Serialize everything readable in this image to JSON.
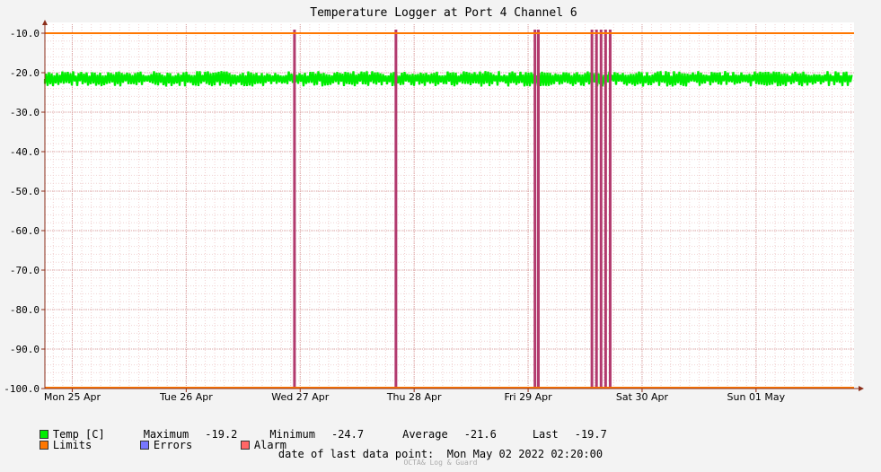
{
  "chart_data": {
    "type": "line",
    "title": "Temperature Logger at Port 4 Channel 6",
    "ylim": [
      -100,
      -10
    ],
    "yticks": [
      -10,
      -20,
      -30,
      -40,
      -50,
      -60,
      -70,
      -80,
      -90,
      -100
    ],
    "ytick_labels": [
      "-10.0",
      "-20.0",
      "-30.0",
      "-40.0",
      "-50.0",
      "-60.0",
      "-70.0",
      "-80.0",
      "-90.0",
      "-100.0"
    ],
    "x_range_days": [
      -0.24,
      6.86
    ],
    "x_ticks": [
      {
        "day": 0,
        "label": "Mon 25 Apr"
      },
      {
        "day": 1,
        "label": "Tue 26 Apr"
      },
      {
        "day": 2,
        "label": "Wed 27 Apr"
      },
      {
        "day": 3,
        "label": "Thu 28 Apr"
      },
      {
        "day": 4,
        "label": "Fri 29 Apr"
      },
      {
        "day": 5,
        "label": "Sat 30 Apr"
      },
      {
        "day": 6,
        "label": "Sun 01 May"
      }
    ],
    "grid": true,
    "series": [
      {
        "name": "Temp [C]",
        "color": "#00ee00",
        "band": [
          -24.7,
          -19.2
        ],
        "mean": -21.6
      },
      {
        "name": "Limits",
        "color": "#ff7700",
        "upper": -10.0,
        "lower": -100.0
      },
      {
        "name": "Errors",
        "color": "#7777ff",
        "days": []
      },
      {
        "name": "Alarm",
        "color": "#ff6666",
        "days": [
          1.95,
          2.84,
          4.06,
          4.09,
          4.56,
          4.6,
          4.64,
          4.68,
          4.72
        ]
      }
    ],
    "error_bar_color": "#b23a6e"
  },
  "legend": {
    "temp_label": "Temp [C]",
    "limits_label": "Limits",
    "errors_label": "Errors",
    "alarm_label": "Alarm",
    "stats": {
      "max_label": "Maximum",
      "max_value": "-19.2",
      "min_label": "Minimum",
      "min_value": "-24.7",
      "avg_label": "Average",
      "avg_value": "-21.6",
      "last_label": "Last",
      "last_value": "-19.7"
    }
  },
  "footer": {
    "last_data_label": "date of last data point:",
    "last_data_value": "Mon May 02 2022 02:20:00",
    "credit": "OCTA& Log & Guard"
  },
  "colors": {
    "background": "#f3f3f3",
    "plot_bg": "#ffffff",
    "temp": "#00ee00",
    "limits": "#ff7700",
    "errors": "#7777ff",
    "alarm": "#ff6666",
    "alarm_bars": "#b23a6e",
    "axis": "#8b2e1a"
  }
}
